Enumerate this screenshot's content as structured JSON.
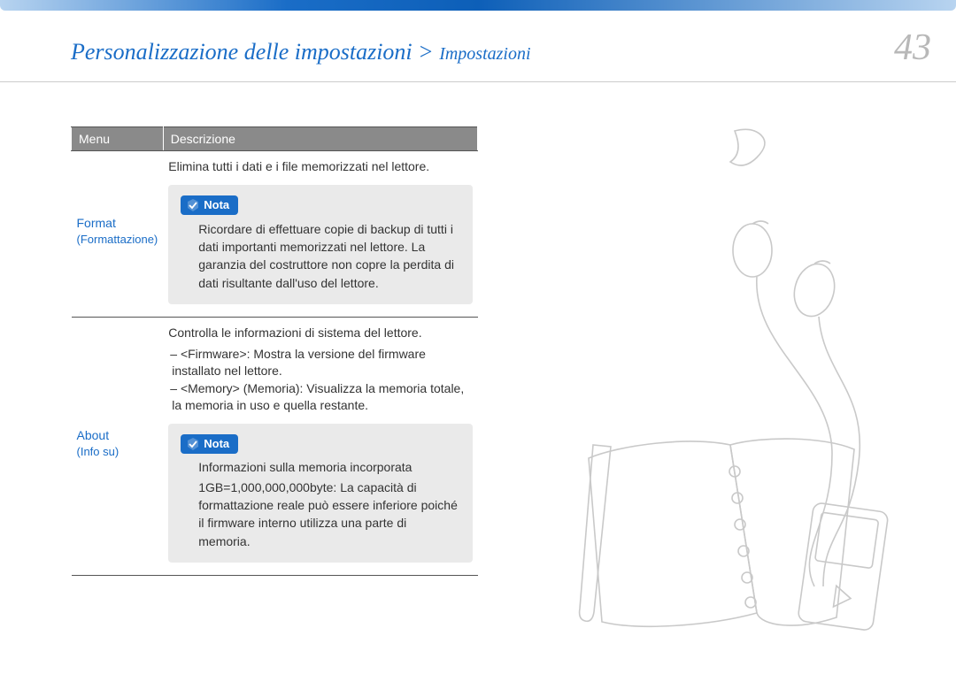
{
  "header": {
    "breadcrumb_main": "Personalizzazione delle impostazioni > ",
    "breadcrumb_sub": "Impostazioni",
    "page_number": "43"
  },
  "table": {
    "head_menu": "Menu",
    "head_desc": "Descrizione",
    "rows": [
      {
        "menu": "Format",
        "menu_sub": "(Formattazione)",
        "desc_intro": "Elimina tutti i dati e i file memorizzati nel lettore.",
        "note_label": "Nota",
        "note_body": "Ricordare di effettuare copie di backup di tutti i dati importanti memorizzati nel lettore. La garanzia del costruttore non copre la perdita di dati risultante dall'uso del lettore."
      },
      {
        "menu": "About",
        "menu_sub": "(Info su)",
        "desc_intro": "Controlla le informazioni di sistema del lettore.",
        "bullets": [
          "<Firmware>: Mostra la versione del firmware installato nel lettore.",
          "<Memory> (Memoria): Visualizza la memoria totale, la memoria in uso e quella restante."
        ],
        "note_label": "Nota",
        "note_heading": "Informazioni sulla memoria incorporata",
        "note_body": "1GB=1,000,000,000byte: La capacità di formattazione reale può essere inferiore poiché il firmware interno utilizza una parte di memoria."
      }
    ]
  }
}
